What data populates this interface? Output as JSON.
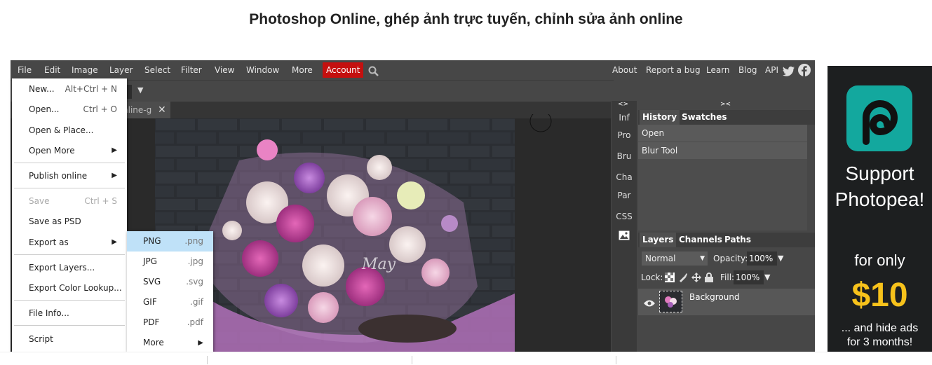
{
  "page": {
    "title": "Photoshop Online, ghép ảnh trực tuyến, chỉnh sửa ảnh online"
  },
  "menubar": {
    "items": [
      "File",
      "Edit",
      "Image",
      "Layer",
      "Select",
      "Filter",
      "View",
      "Window",
      "More"
    ],
    "account": "Account",
    "right_links": [
      "About",
      "Report a bug",
      "Learn",
      "Blog",
      "API"
    ]
  },
  "tab": {
    "title": "nline-g"
  },
  "side_toolbar": [
    "Inf",
    "Pro",
    "Bru",
    "Cha",
    "Par",
    "CSS"
  ],
  "panel_toggles": {
    "left": "<>",
    "right": "><"
  },
  "history_panel": {
    "tabs": [
      "History",
      "Swatches"
    ],
    "rows": [
      "Open",
      "Blur Tool"
    ]
  },
  "layers_panel": {
    "tabs": [
      "Layers",
      "Channels",
      "Paths"
    ],
    "blend_mode": "Normal",
    "opacity_label": "Opacity:",
    "opacity_value": "100%",
    "lock_label": "Lock:",
    "fill_label": "Fill:",
    "fill_value": "100%",
    "layer_name": "Background"
  },
  "file_menu": {
    "items": [
      {
        "label": "New...",
        "shortcut": "Alt+Ctrl + N"
      },
      {
        "label": "Open...",
        "shortcut": "Ctrl + O"
      },
      {
        "label": "Open & Place..."
      },
      {
        "label": "Open More",
        "submenu": true
      },
      {
        "label": "Publish online",
        "submenu": true
      },
      {
        "label": "Save",
        "shortcut": "Ctrl + S",
        "disabled": true
      },
      {
        "label": "Save as PSD"
      },
      {
        "label": "Export as",
        "submenu": true
      },
      {
        "label": "Export Layers..."
      },
      {
        "label": "Export Color Lookup..."
      },
      {
        "label": "File Info..."
      },
      {
        "label": "Script"
      }
    ]
  },
  "export_submenu": {
    "items": [
      {
        "label": "PNG",
        "ext": ".png",
        "highlighted": true
      },
      {
        "label": "JPG",
        "ext": ".jpg"
      },
      {
        "label": "SVG",
        "ext": ".svg"
      },
      {
        "label": "GIF",
        "ext": ".gif"
      },
      {
        "label": "PDF",
        "ext": ".pdf"
      },
      {
        "label": "More",
        "submenu": true
      }
    ]
  },
  "ad": {
    "line1": "Support",
    "line2": "Photopea!",
    "line3": "for only",
    "price": "$10",
    "line4": "... and hide ads",
    "line5": "for 3 months!"
  },
  "colors": {
    "accent_red": "#c4100f",
    "ad_teal": "#13a89e",
    "ad_price": "#f7c21b",
    "highlight": "#bfe1f8"
  },
  "canvas_watermark": "May"
}
